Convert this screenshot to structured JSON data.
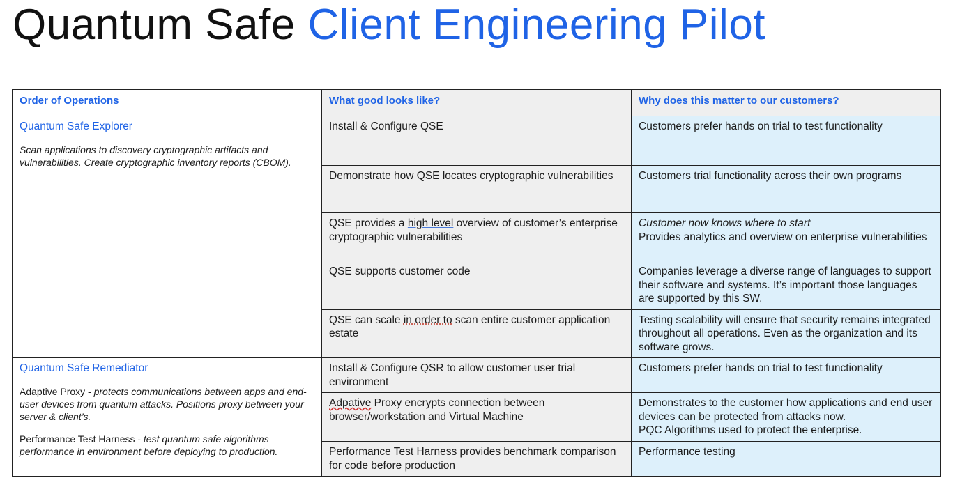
{
  "title": {
    "part1": "Quantum Safe",
    "part2": "Client Engineering Pilot"
  },
  "table": {
    "headers": [
      "Order of Operations",
      "What good looks like?",
      "Why does this matter to our customers?"
    ],
    "sections": [
      {
        "title": "Quantum Safe Explorer",
        "description": "Scan applications to discovery cryptographic artifacts and vulnerabilities. Create cryptographic inventory reports (CBOM).",
        "rows": [
          {
            "good": "Install & Configure QSE",
            "why": "Customers prefer hands on trial to test functionality"
          },
          {
            "good": "Demonstrate how QSE locates cryptographic vulnerabilities",
            "why": "Customers trial functionality across their own programs"
          },
          {
            "good_pre": "QSE provides a ",
            "good_mark": "high level",
            "good_post": " overview of customer’s enterprise cryptographic vulnerabilities",
            "why_italic": "Customer now knows where to start",
            "why": "Provides analytics and overview on enterprise vulnerabilities"
          },
          {
            "good": "QSE supports customer code",
            "why": "Companies leverage a diverse range of languages to support their software and systems. It’s important those languages are supported by this SW."
          },
          {
            "good_pre": "QSE can scale ",
            "good_mark": "in order to",
            "good_post": " scan entire customer application estate",
            "why": "Testing scalability will ensure that security remains integrated throughout all operations. Even as the organization and its software grows."
          }
        ]
      },
      {
        "title": "Quantum Safe Remediator",
        "para1_label": "Adaptive Proxy - ",
        "para1_text": "protects communications between apps and end-user devices from quantum attacks. Positions proxy between your server & client’s.",
        "para2_label": "Performance Test Harness - ",
        "para2_text": "test quantum safe algorithms performance in environment before deploying to production.",
        "rows": [
          {
            "good": "Install & Configure QSR to allow customer user trial environment",
            "why": "Customers prefer hands on trial to test functionality"
          },
          {
            "good_mark": "Adpative",
            "good_post": " Proxy encrypts connection between browser/workstation and Virtual Machine",
            "why": "Demonstrates to the customer how applications and end user devices can be protected from attacks now.",
            "why2": "PQC Algorithms used to protect the enterprise."
          },
          {
            "good": "Performance Test Harness provides  benchmark comparison for code before production",
            "why": "Performance testing"
          }
        ]
      }
    ]
  }
}
